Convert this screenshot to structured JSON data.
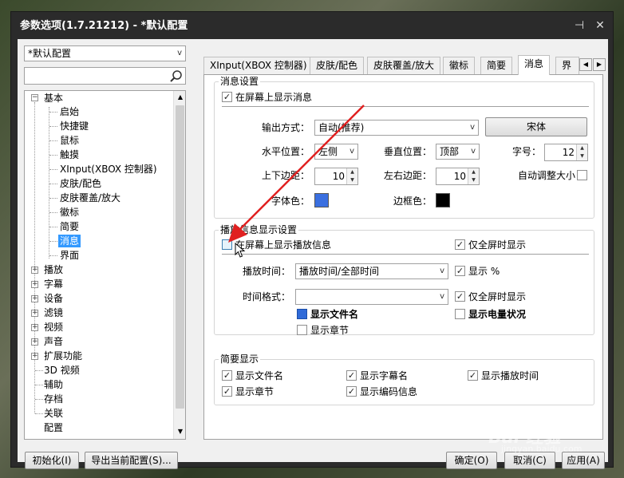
{
  "window": {
    "title": "参数选项(1.7.21212) - *默认配置",
    "pin_icon": "pin-icon",
    "close_label": "✕"
  },
  "left": {
    "profile_select": "*默认配置",
    "search_placeholder": "",
    "tree": {
      "basic": "基本",
      "basic_children": [
        "启始",
        "快捷键",
        "鼠标",
        "触摸",
        "XInput(XBOX 控制器)",
        "皮肤/配色",
        "皮肤覆盖/放大",
        "徽标",
        "简要",
        "消息",
        "界面"
      ],
      "others": [
        "播放",
        "字幕",
        "设备",
        "滤镜",
        "视频",
        "声音",
        "扩展功能",
        "3D 视频",
        "辅助",
        "存档",
        "关联",
        "配置"
      ]
    }
  },
  "tabs": [
    "XInput(XBOX 控制器)",
    "皮肤/配色",
    "皮肤覆盖/放大",
    "徽标",
    "简要",
    "消息",
    "界"
  ],
  "active_tab": "消息",
  "msg": {
    "group_title": "消息设置",
    "show_onscreen": "在屏幕上显示消息",
    "output_label": "输出方式：",
    "output_value": "自动(推荐)",
    "font_button": "宋体",
    "hpos_label": "水平位置：",
    "hpos_value": "左侧",
    "vpos_label": "垂直位置：",
    "vpos_value": "顶部",
    "size_label": "字号：",
    "size_value": "12",
    "tb_margin_label": "上下边距：",
    "tb_margin_value": "10",
    "lr_margin_label": "左右边距：",
    "lr_margin_value": "10",
    "auto_size": "自动调整大小",
    "font_color_label": "字体色：",
    "border_color_label": "边框色：",
    "font_color": "#3a6fe0",
    "border_color": "#000000"
  },
  "play": {
    "group_title": "播放信息显示设置",
    "show_play_info": "在屏幕上显示播放信息",
    "fullscreen_only": "仅全屏时显示",
    "time_label": "播放时间：",
    "time_value": "播放时间/全部时间",
    "show_percent": "显示 %",
    "time_format_label": "时间格式：",
    "time_format_value": "",
    "fullscreen_only2": "仅全屏时显示",
    "show_filename": "显示文件名",
    "show_battery": "显示电量状况",
    "show_chapter": "显示章节"
  },
  "brief": {
    "group_title": "简要显示",
    "items": [
      "显示文件名",
      "显示字幕名",
      "显示播放时间",
      "显示章节",
      "显示编码信息"
    ]
  },
  "buttons": {
    "init": "初始化(I)",
    "export": "导出当前配置(S)...",
    "ok": "确定(O)",
    "cancel": "取消(C)",
    "apply": "应用(A)"
  },
  "watermark": {
    "brand": "Bai 经验",
    "url": "jingyan.baidu.com"
  }
}
